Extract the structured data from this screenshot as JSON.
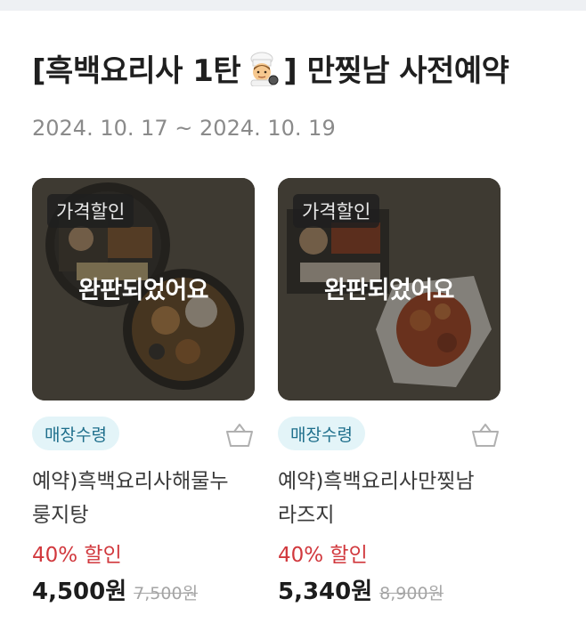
{
  "header": {
    "title_part1": "[흑백요리사 1탄",
    "title_part2": "] 만찢남 사전예약",
    "date_range": "2024. 10. 17 ~ 2024. 10. 19"
  },
  "products": [
    {
      "discount_badge": "가격할인",
      "soldout_text": "완판되었어요",
      "pickup_badge": "매장수령",
      "name": "예약)흑백요리사해물누룽지탕",
      "discount_text": "40% 할인",
      "price": "4,500원",
      "original_price": "7,500원"
    },
    {
      "discount_badge": "가격할인",
      "soldout_text": "완판되었어요",
      "pickup_badge": "매장수령",
      "name": "예약)흑백요리사만찢남라즈지",
      "discount_text": "40% 할인",
      "price": "5,340원",
      "original_price": "8,900원"
    }
  ],
  "colors": {
    "discount_red": "#d1383d",
    "pickup_badge_bg": "#e3f4f8",
    "pickup_badge_text": "#1f6f8c"
  },
  "icons": {
    "title_emoji": "chef-icon",
    "cart": "cart-icon"
  }
}
